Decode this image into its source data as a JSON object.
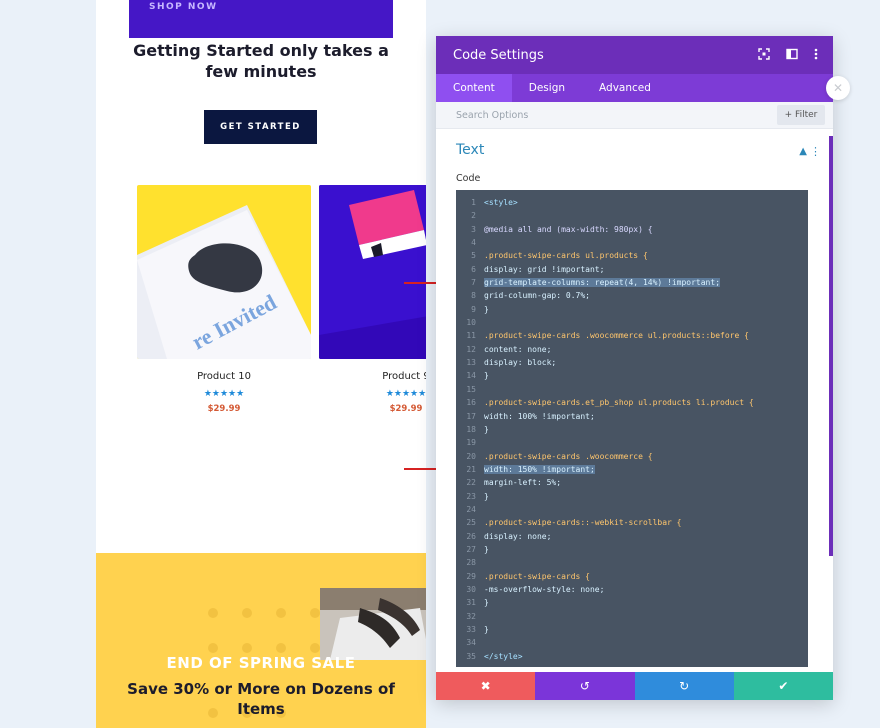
{
  "page": {
    "shop_now": "SHOP NOW",
    "headline": "Getting Started only takes a few minutes",
    "get_started": "GET STARTED",
    "products": [
      {
        "name": "Product 10",
        "rating": 5,
        "stars": "★★★★★",
        "price": "$29.99"
      },
      {
        "name": "Product 9",
        "rating": 5,
        "stars": "★★★★★",
        "price": "$29.99"
      }
    ],
    "product_a_image_text": "re Invited",
    "sale_title": "END OF SPRING SALE",
    "sale_subtitle": "Save 30% or More on Dozens of Items"
  },
  "modal": {
    "title": "Code Settings",
    "tabs": [
      {
        "label": "Content",
        "active": true
      },
      {
        "label": "Design",
        "active": false
      },
      {
        "label": "Advanced",
        "active": false
      }
    ],
    "search_placeholder": "Search Options",
    "filter_label": "+ Filter",
    "section_title": "Text",
    "code_label": "Code",
    "code_lines": [
      {
        "n": "1",
        "t": "<style>",
        "k": "tag"
      },
      {
        "n": "2",
        "t": "",
        "k": ""
      },
      {
        "n": "3",
        "t": "@media all and (max-width: 980px) {",
        "k": "kw"
      },
      {
        "n": "4",
        "t": "",
        "k": ""
      },
      {
        "n": "5",
        "t": ".product-swipe-cards ul.products {",
        "k": "sel"
      },
      {
        "n": "6",
        "t": "display: grid !important;",
        "k": "prop"
      },
      {
        "n": "7",
        "t": "grid-template-columns: repeat(4, 14%) !important;",
        "k": "prop",
        "hl": true
      },
      {
        "n": "8",
        "t": "grid-column-gap: 0.7%;",
        "k": "prop"
      },
      {
        "n": "9",
        "t": "}",
        "k": ""
      },
      {
        "n": "10",
        "t": "",
        "k": ""
      },
      {
        "n": "11",
        "t": ".product-swipe-cards .woocommerce ul.products::before {",
        "k": "sel"
      },
      {
        "n": "12",
        "t": "content: none;",
        "k": "prop"
      },
      {
        "n": "13",
        "t": "display: block;",
        "k": "prop"
      },
      {
        "n": "14",
        "t": "}",
        "k": ""
      },
      {
        "n": "15",
        "t": "",
        "k": ""
      },
      {
        "n": "16",
        "t": ".product-swipe-cards.et_pb_shop ul.products li.product {",
        "k": "sel"
      },
      {
        "n": "17",
        "t": "width: 100% !important;",
        "k": "prop"
      },
      {
        "n": "18",
        "t": "}",
        "k": ""
      },
      {
        "n": "19",
        "t": "",
        "k": ""
      },
      {
        "n": "20",
        "t": ".product-swipe-cards .woocommerce {",
        "k": "sel"
      },
      {
        "n": "21",
        "t": "width: 150% !important;",
        "k": "prop",
        "hl": true
      },
      {
        "n": "22",
        "t": "margin-left: 5%;",
        "k": "prop"
      },
      {
        "n": "23",
        "t": "}",
        "k": ""
      },
      {
        "n": "24",
        "t": "",
        "k": ""
      },
      {
        "n": "25",
        "t": ".product-swipe-cards::-webkit-scrollbar {",
        "k": "sel"
      },
      {
        "n": "26",
        "t": "display: none;",
        "k": "prop"
      },
      {
        "n": "27",
        "t": "}",
        "k": ""
      },
      {
        "n": "28",
        "t": "",
        "k": ""
      },
      {
        "n": "29",
        "t": ".product-swipe-cards {",
        "k": "sel"
      },
      {
        "n": "30",
        "t": "-ms-overflow-style: none;",
        "k": "prop"
      },
      {
        "n": "31",
        "t": "}",
        "k": ""
      },
      {
        "n": "32",
        "t": "",
        "k": ""
      },
      {
        "n": "33",
        "t": "}",
        "k": ""
      },
      {
        "n": "34",
        "t": "",
        "k": ""
      },
      {
        "n": "35",
        "t": "</style>",
        "k": "tag"
      }
    ],
    "footer": {
      "discard": "✖",
      "undo": "↺",
      "redo": "↻",
      "save": "✔"
    }
  },
  "colors": {
    "modal_header": "#6c2eb9",
    "tab_bar": "#7d3bd6",
    "code_bg": "#485463",
    "discard": "#ef5b5d",
    "undo": "#7b35d9",
    "redo": "#2f8cdc",
    "save": "#2ebd9f",
    "sale_bg": "#ffd24f"
  }
}
